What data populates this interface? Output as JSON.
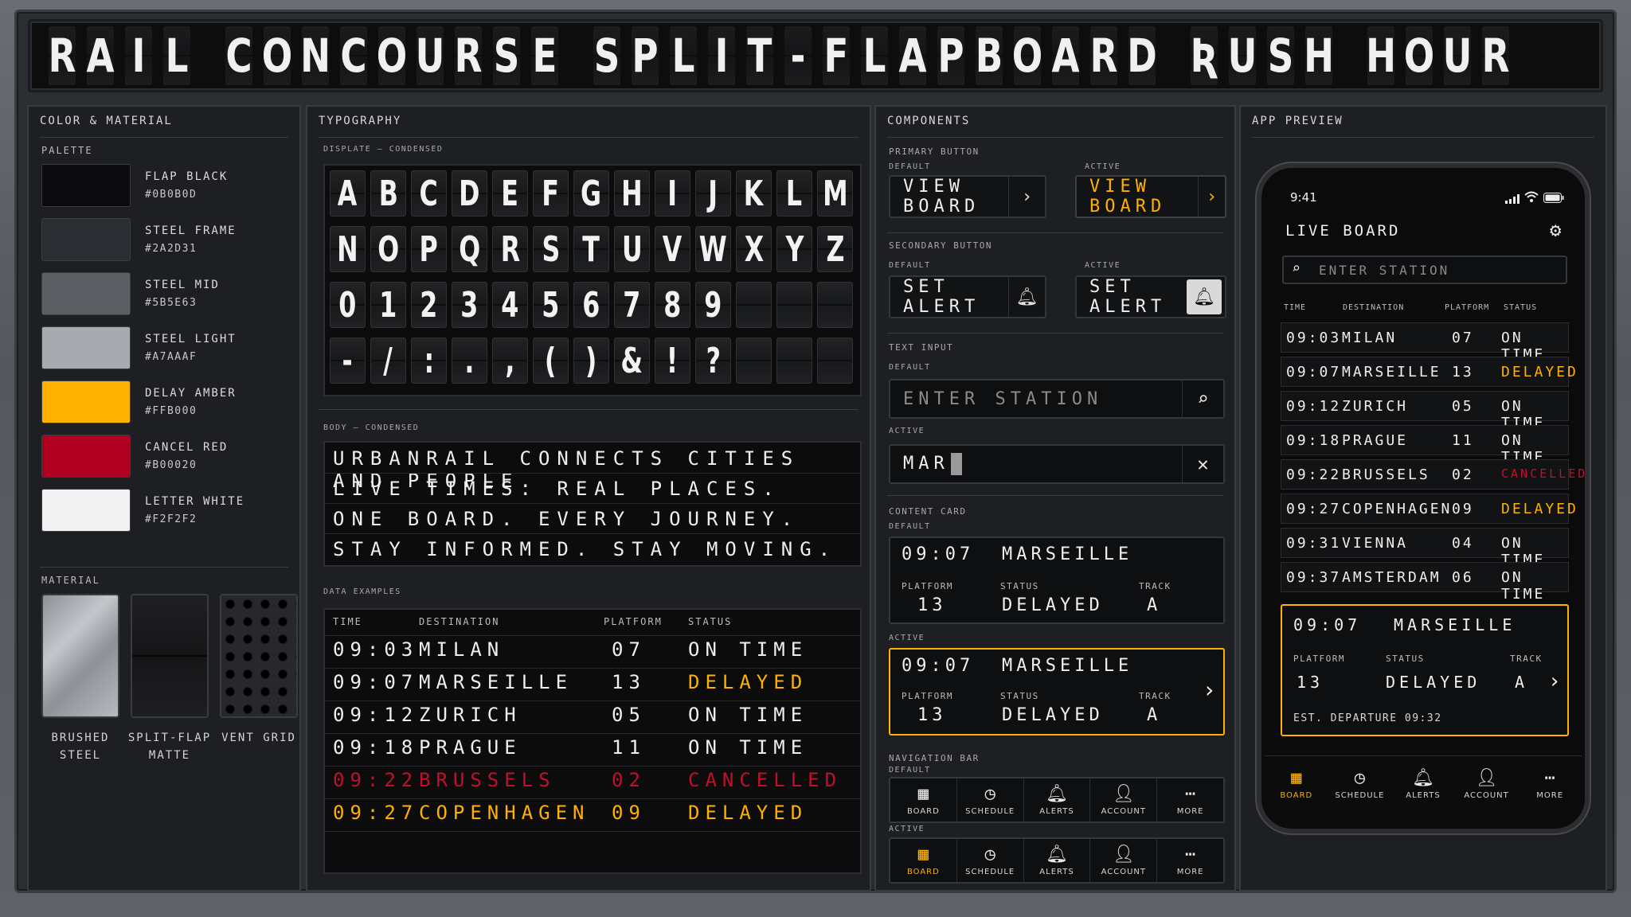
{
  "title": [
    "R",
    "A",
    "I",
    "L",
    " ",
    "C",
    "O",
    "N",
    "C",
    "O",
    "U",
    "R",
    "S",
    "E",
    " ",
    "S",
    "P",
    "L",
    "I",
    "T",
    "-",
    "F",
    "L",
    "A",
    "P",
    "B",
    "O",
    "A",
    "R",
    "D",
    " ",
    "Ʀ",
    "U",
    "S",
    "H",
    " ",
    "H",
    "O",
    "U",
    "R"
  ],
  "panels": {
    "color_material": "COLOR & MATERIAL",
    "typography": "TYPOGRAPHY",
    "components": "COMPONENTS",
    "app_preview": "APP PREVIEW"
  },
  "palette": {
    "label": "PALETTE",
    "swatches": [
      {
        "name": "FLAP BLACK",
        "hex": "#0B0B0D",
        "color": "#0B0B0D"
      },
      {
        "name": "STEEL FRAME",
        "hex": "#2A2D31",
        "color": "#2A2D31"
      },
      {
        "name": "STEEL MID",
        "hex": "#5B5E63",
        "color": "#5B5E63"
      },
      {
        "name": "STEEL LIGHT",
        "hex": "#A7AAAF",
        "color": "#A7AAAF"
      },
      {
        "name": "DELAY AMBER",
        "hex": "#FFB000",
        "color": "#FFB000"
      },
      {
        "name": "CANCEL RED",
        "hex": "#B00020",
        "color": "#B00020"
      },
      {
        "name": "LETTER WHITE",
        "hex": "#F2F2F2",
        "color": "#F2F2F2"
      }
    ]
  },
  "material": {
    "label": "MATERIAL",
    "items": [
      {
        "line1": "BRUSHED",
        "line2": "STEEL"
      },
      {
        "line1": "SPLIT-FLAP",
        "line2": "MATTE"
      },
      {
        "line1": "VENT GRID",
        "line2": ""
      }
    ]
  },
  "typography": {
    "display_label": "DISPLATE — CONDENSED",
    "rows": [
      [
        "A",
        "B",
        "C",
        "D",
        "E",
        "F",
        "G",
        "H",
        "I",
        "J",
        "K",
        "L",
        "M"
      ],
      [
        "N",
        "O",
        "P",
        "Q",
        "R",
        "S",
        "T",
        "U",
        "V",
        "W",
        "X",
        "Y",
        "Z"
      ],
      [
        "0",
        "1",
        "2",
        "3",
        "4",
        "5",
        "6",
        "7",
        "8",
        "9",
        "",
        "",
        ""
      ],
      [
        "-",
        "/",
        ":",
        ".",
        ",",
        "(",
        ")",
        "&",
        "!",
        "?",
        "",
        "",
        ""
      ]
    ],
    "body_label": "BODY — CONDENSED",
    "body_lines": [
      "URBANRAIL CONNECTS CITIES AND PEOPLE.",
      "LIVE TIMES. REAL PLACES.",
      "ONE BOARD. EVERY JOURNEY.",
      "STAY INFORMED. STAY MOVING."
    ],
    "data_label": "DATA EXAMPLES",
    "headers": {
      "time": "TIME",
      "destination": "DESTINATION",
      "platform": "PLATFORM",
      "status": "STATUS"
    },
    "data_rows": [
      {
        "time": "09:03",
        "dest": "MILAN",
        "plat": "07",
        "status": "ON TIME",
        "tone": "normal"
      },
      {
        "time": "09:07",
        "dest": "MARSEILLE",
        "plat": "13",
        "status": "DELAYED",
        "tone": "delayed"
      },
      {
        "time": "09:12",
        "dest": "ZURICH",
        "plat": "05",
        "status": "ON TIME",
        "tone": "normal"
      },
      {
        "time": "09:18",
        "dest": "PRAGUE",
        "plat": "11",
        "status": "ON TIME",
        "tone": "normal"
      },
      {
        "time": "09:22",
        "dest": "BRUSSELS",
        "plat": "02",
        "status": "CANCELLED",
        "tone": "cancelled"
      },
      {
        "time": "09:27",
        "dest": "COPENHAGEN",
        "plat": "09",
        "status": "DELAYED",
        "tone": "delayedrow"
      }
    ]
  },
  "components": {
    "primary_label": "PRIMARY BUTTON",
    "secondary_label": "SECONDARY BUTTON",
    "input_label": "TEXT INPUT",
    "card_label": "CONTENT CARD",
    "nav_label": "NAVIGATION BAR",
    "default": "DEFAULT",
    "active": "ACTIVE",
    "primary_text": "VIEW BOARD",
    "secondary_text": "SET ALERT",
    "input_placeholder": "ENTER STATION",
    "input_active_value": "MAR",
    "card": {
      "time": "09:07",
      "dest": "MARSEILLE",
      "platform_label": "PLATFORM",
      "status_label": "STATUS",
      "track_label": "TRACK",
      "platform": "13",
      "status": "DELAYED",
      "track": "A"
    },
    "nav_items": [
      "BOARD",
      "SCHEDULE",
      "ALERTS",
      "ACCOUNT",
      "MORE"
    ]
  },
  "phone": {
    "time": "9:41",
    "header": "LIVE BOARD",
    "search_placeholder": "ENTER STATION",
    "headers": {
      "time": "TIME",
      "destination": "DESTINATION",
      "platform": "PLATFORM",
      "status": "STATUS"
    },
    "rows": [
      {
        "time": "09:03",
        "dest": "MILAN",
        "plat": "07",
        "status": "ON TIME",
        "tone": "normal"
      },
      {
        "time": "09:07",
        "dest": "MARSEILLE",
        "plat": "13",
        "status": "DELAYED",
        "tone": "delayed"
      },
      {
        "time": "09:12",
        "dest": "ZURICH",
        "plat": "05",
        "status": "ON TIME",
        "tone": "normal"
      },
      {
        "time": "09:18",
        "dest": "PRAGUE",
        "plat": "11",
        "status": "ON TIME",
        "tone": "normal"
      },
      {
        "time": "09:22",
        "dest": "BRUSSELS",
        "plat": "02",
        "status": "CANCELLED",
        "tone": "cancelled"
      },
      {
        "time": "09:27",
        "dest": "COPENHAGEN",
        "plat": "09",
        "status": "DELAYED",
        "tone": "delayed"
      },
      {
        "time": "09:31",
        "dest": "VIENNA",
        "plat": "04",
        "status": "ON TIME",
        "tone": "normal"
      },
      {
        "time": "09:37",
        "dest": "AMSTERDAM",
        "plat": "06",
        "status": "ON TIME",
        "tone": "normal"
      }
    ],
    "card": {
      "time": "09:07",
      "dest": "MARSEILLE",
      "platform_label": "PLATFORM",
      "status_label": "STATUS",
      "track_label": "TRACK",
      "platform": "13",
      "status": "DELAYED",
      "track": "A",
      "est": "EST. DEPARTURE 09:32"
    },
    "nav_items": [
      "BOARD",
      "SCHEDULE",
      "ALERTS",
      "ACCOUNT",
      "MORE"
    ]
  },
  "colors": {
    "amber": "#FFB000",
    "red": "#C0112A",
    "white": "#EFEFEF"
  },
  "icons": [
    "chevron-right-icon",
    "bell-icon",
    "search-icon",
    "close-icon",
    "gear-icon",
    "grid-icon",
    "clock-icon",
    "user-icon",
    "more-icon",
    "signal-icon",
    "wifi-icon",
    "battery-icon"
  ]
}
